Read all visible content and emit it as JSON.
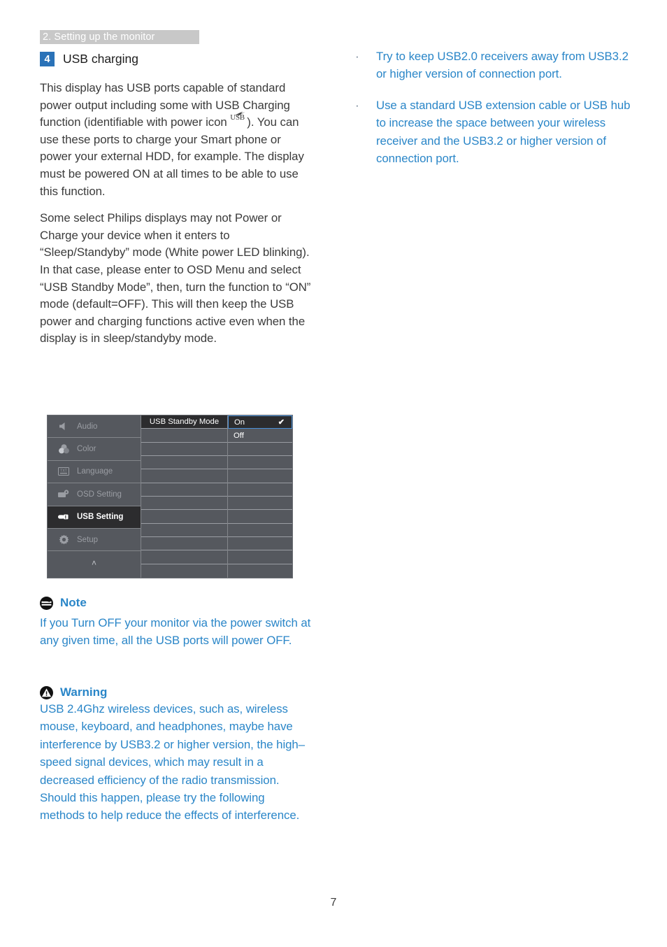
{
  "header": {
    "chapter": "2. Setting up the monitor"
  },
  "section": {
    "number": "4",
    "title": "USB charging"
  },
  "left_column": {
    "paragraph_1_part_1": "This display has USB ports capable of standard power output including some with USB Charging function (identifiable with power icon ",
    "usb_icon_label": "USB",
    "paragraph_1_part_2": "). You can use these ports to charge your Smart phone or power your external HDD, for example. The display must be powered ON at all times to be able to use this function.",
    "paragraph_2": "Some select Philips displays may not Power or Charge your device when it enters to “Sleep/Standyby” mode (White power LED blinking). In that case, please enter to OSD Menu and select “USB Standby Mode”, then, turn the function to “ON” mode (default=OFF). This will then keep the USB power and charging functions active even when the display is in sleep/standyby mode."
  },
  "right_column": {
    "bullets": [
      {
        "marker": "·",
        "text": "Try to keep USB2.0 receivers away from USB3.2 or higher version of connection port."
      },
      {
        "marker": "·",
        "text": "Use a standard USB extension cable or USB hub to increase the space between your wireless receiver and the USB3.2 or higher version of connection port."
      }
    ]
  },
  "osd": {
    "sidebar_items": [
      {
        "icon": "speaker-icon",
        "label": "Audio",
        "active": false
      },
      {
        "icon": "color-circles-icon",
        "label": "Color",
        "active": false
      },
      {
        "icon": "text-language-icon",
        "label": "Language",
        "active": false
      },
      {
        "icon": "osd-setting-icon",
        "label": "OSD Setting",
        "active": false
      },
      {
        "icon": "usb-setting-icon",
        "label": "USB Setting",
        "active": true
      },
      {
        "icon": "gear-icon",
        "label": "Setup",
        "active": false
      },
      {
        "icon": "chevron-up-icon",
        "label": "˄",
        "active": false
      }
    ],
    "middle_header": "USB Standby Mode",
    "options": [
      {
        "label": "On",
        "selected": true,
        "checked": true
      },
      {
        "label": "Off",
        "selected": false,
        "checked": false
      }
    ]
  },
  "note": {
    "icon": "note-icon",
    "title": "Note",
    "body": "If you Turn OFF your monitor via the power switch at any given time, all the USB ports will power OFF."
  },
  "warning": {
    "icon": "warning-icon",
    "title": "Warning",
    "body": "USB 2.4Ghz wireless devices, such as, wireless mouse, keyboard, and headphones, maybe have interference by USB3.2 or higher version, the high–speed signal devices, which may result in a decreased efficiency of the radio transmission.  Should this happen, please try the following methods to help reduce the effects of interference."
  },
  "footer": {
    "page_number": "7"
  },
  "colors": {
    "accent_blue": "#2a86c8",
    "badge_blue": "#2a72b8",
    "chapter_bar_gray": "#c8c8c8",
    "body_text": "#3b3b3b",
    "osd_bg": "#55585e",
    "osd_active": "#2c2c2e",
    "osd_highlight_border": "#4a90d9"
  }
}
